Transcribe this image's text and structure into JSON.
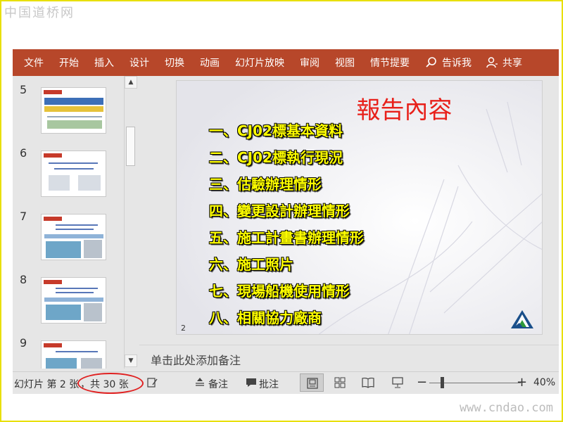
{
  "watermark": {
    "top": "中国道桥网",
    "bottom": "www.cndao.com"
  },
  "ribbon": {
    "tabs": [
      "文件",
      "开始",
      "插入",
      "设计",
      "切换",
      "动画",
      "幻灯片放映",
      "审阅",
      "视图",
      "情节提要"
    ],
    "tell_me": "告诉我",
    "share": "共享"
  },
  "thumbnails": [
    {
      "number": "5"
    },
    {
      "number": "6"
    },
    {
      "number": "7"
    },
    {
      "number": "8"
    },
    {
      "number": "9"
    }
  ],
  "slide": {
    "title": "報告內容",
    "items": [
      "一、CJ02標基本資料",
      "二、CJ02標執行現況",
      "三、估驗辦理情形",
      "四、變更設計辦理情形",
      "五、施工計畫書辦理情形",
      "六、施工照片",
      "七、現場船機使用情形",
      "八、相關協力廠商"
    ],
    "number": "2",
    "title_color": "#e8201a",
    "item_color": "#ffff00"
  },
  "notes": {
    "placeholder": "单击此处添加备注"
  },
  "status": {
    "slide_info": "幻灯片 第 2 张",
    "total": "，共 30 张",
    "notes_btn": "备注",
    "comments_btn": "批注",
    "zoom": "40%",
    "minus": "−",
    "plus": "+"
  },
  "colors": {
    "ribbon": "#b7472a",
    "annotation_circle": "#e02020",
    "frame": "#e8e000"
  }
}
